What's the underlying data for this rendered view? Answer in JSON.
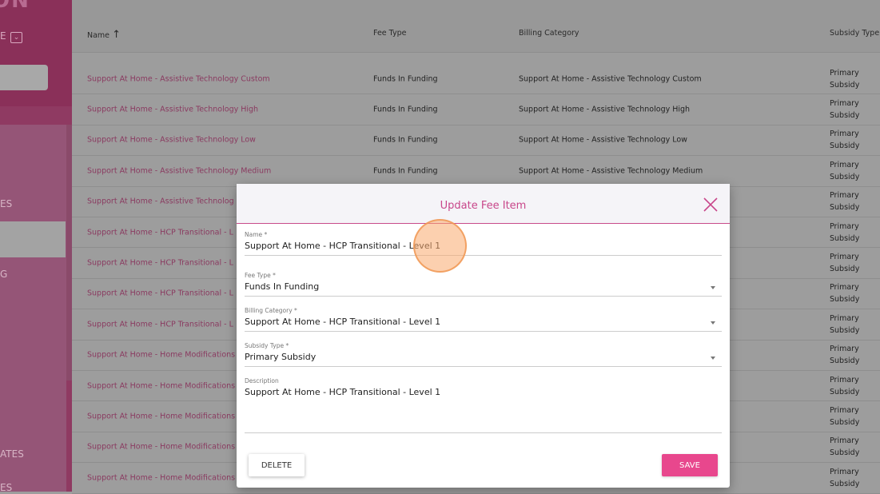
{
  "sidebar": {
    "logo": "ON",
    "selector_text": "E",
    "search_text": "?",
    "items": [
      {
        "label": "ES"
      },
      {
        "label": "G"
      },
      {
        "label": "ATES"
      },
      {
        "label": "ES"
      }
    ]
  },
  "table": {
    "headers": {
      "name": "Name",
      "fee_type": "Fee Type",
      "billing_category": "Billing Category",
      "subsidy_type": "Subsidy Type"
    },
    "rows": [
      {
        "name": "Support At Home - Assistive Technology Custom",
        "fee_type": "Funds In Funding",
        "billing_category": "Support At Home - Assistive Technology Custom",
        "subsidy_type": "Primary Subsidy"
      },
      {
        "name": "Support At Home - Assistive Technology High",
        "fee_type": "Funds In Funding",
        "billing_category": "Support At Home - Assistive Technology High",
        "subsidy_type": "Primary Subsidy"
      },
      {
        "name": "Support At Home - Assistive Technology Low",
        "fee_type": "Funds In Funding",
        "billing_category": "Support At Home - Assistive Technology Low",
        "subsidy_type": "Primary Subsidy"
      },
      {
        "name": "Support At Home - Assistive Technology Medium",
        "fee_type": "Funds In Funding",
        "billing_category": "Support At Home - Assistive Technology Medium",
        "subsidy_type": "Primary Subsidy"
      },
      {
        "name": "Support At Home - Assistive Technolog",
        "subsidy_type": "Primary Subsidy"
      },
      {
        "name": "Support At Home - HCP Transitional - L",
        "subsidy_type": "Primary Subsidy"
      },
      {
        "name": "Support At Home - HCP Transitional - L",
        "subsidy_type": "Primary Subsidy"
      },
      {
        "name": "Support At Home - HCP Transitional - L",
        "subsidy_type": "Primary Subsidy"
      },
      {
        "name": "Support At Home - HCP Transitional - L",
        "subsidy_type": "Primary Subsidy"
      },
      {
        "name": "Support At Home - Home Modifications",
        "subsidy_type": "Primary Subsidy"
      },
      {
        "name": "Support At Home - Home Modifications",
        "subsidy_type": "Primary Subsidy"
      },
      {
        "name": "Support At Home - Home Modifications",
        "subsidy_type": "Primary Subsidy"
      },
      {
        "name": "Support At Home - Home Modifications",
        "subsidy_type": "Primary Subsidy"
      },
      {
        "name": "Support At Home - Home Modifications",
        "subsidy_type": "Primary Subsidy"
      }
    ]
  },
  "modal": {
    "title": "Update Fee Item",
    "fields": {
      "name": {
        "label": "Name *",
        "value": "Support At Home - HCP Transitional - Level 1"
      },
      "fee_type": {
        "label": "Fee Type *",
        "value": "Funds In Funding"
      },
      "billing_category": {
        "label": "Billing Category *",
        "value": "Support At Home - HCP Transitional - Level 1"
      },
      "subsidy_type": {
        "label": "Subsidy Type *",
        "value": "Primary Subsidy"
      },
      "description": {
        "label": "Description",
        "value": "Support At Home - HCP Transitional - Level 1"
      }
    },
    "delete_label": "DELETE",
    "save_label": "SAVE"
  }
}
